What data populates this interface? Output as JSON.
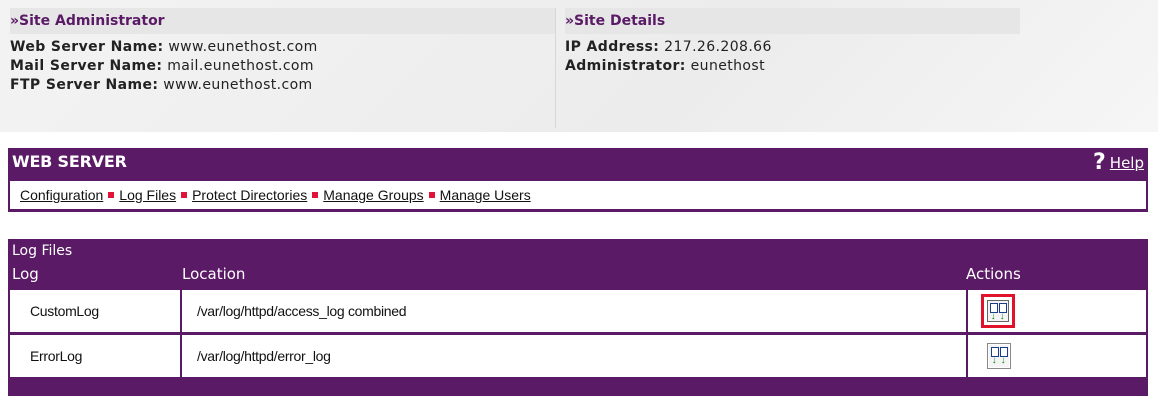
{
  "site_admin": {
    "heading": "»Site Administrator",
    "rows": [
      {
        "label": "Web Server Name:",
        "value": "www.eunethost.com"
      },
      {
        "label": "Mail Server Name:",
        "value": "mail.eunethost.com"
      },
      {
        "label": "FTP Server Name:",
        "value": "www.eunethost.com"
      }
    ]
  },
  "site_details": {
    "heading": "»Site Details",
    "rows": [
      {
        "label": "IP Address:",
        "value": "217.26.208.66"
      },
      {
        "label": "Administrator:",
        "value": "eunethost"
      }
    ]
  },
  "web_server": {
    "title": "WEB SERVER",
    "help_icon": "?",
    "help_label": "Help",
    "nav": [
      "Configuration",
      "Log Files",
      "Protect Directories",
      "Manage Groups",
      "Manage Users"
    ]
  },
  "log_files": {
    "title": "Log Files",
    "columns": [
      "Log",
      "Location",
      "Actions"
    ],
    "rows": [
      {
        "log": "CustomLog",
        "location": "/var/log/httpd/access_log  combined",
        "action_icon": "download-logs-icon"
      },
      {
        "log": "ErrorLog",
        "location": "/var/log/httpd/error_log",
        "action_icon": "download-logs-icon"
      }
    ]
  },
  "colors": {
    "brand": "#5a1a66",
    "separator": "#e0133b",
    "highlight": "#e0132b"
  }
}
